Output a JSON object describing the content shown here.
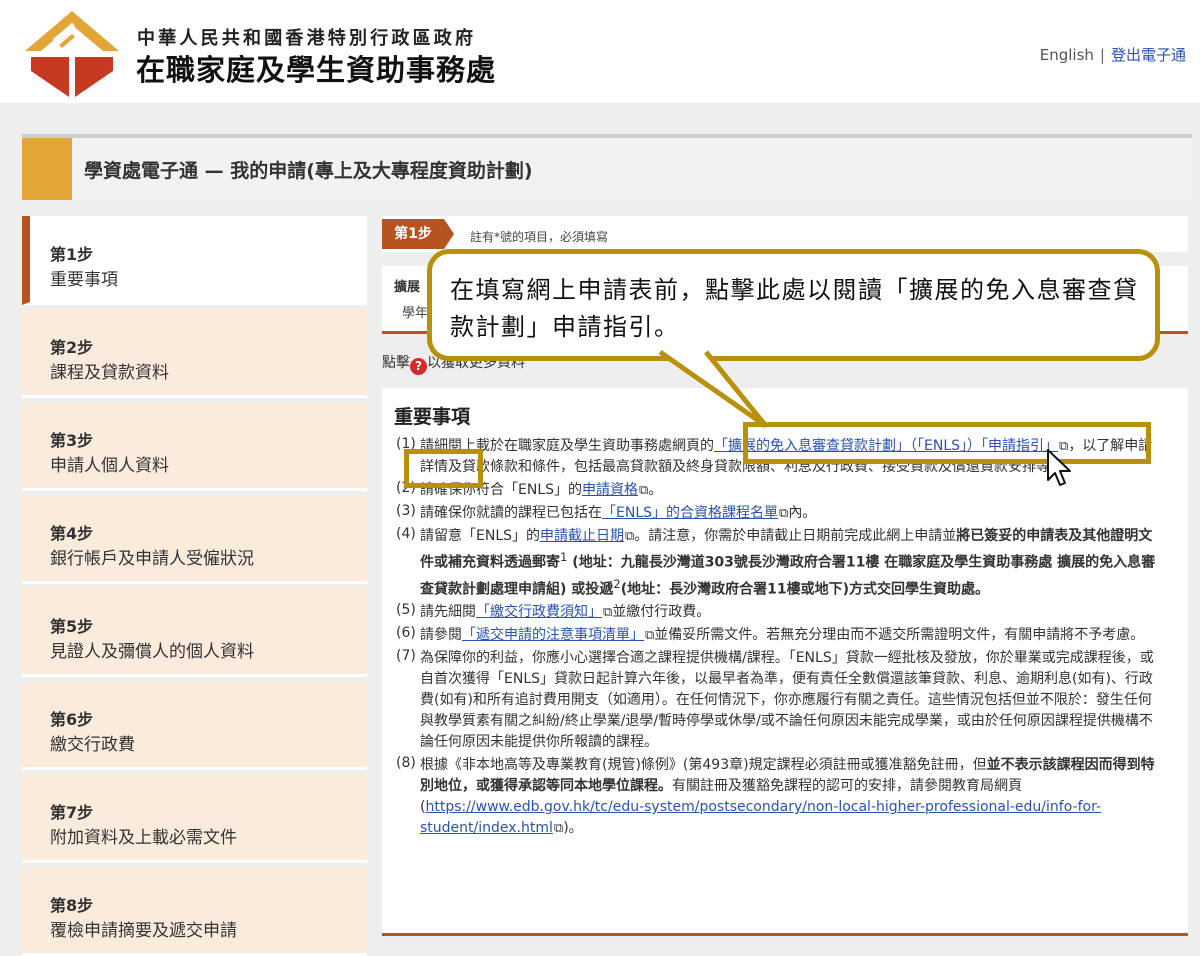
{
  "header": {
    "dept_line1": "中華人民共和國香港特別行政區政府",
    "dept_line2": "在職家庭及學生資助事務處",
    "lang_link": "English",
    "separator": "|",
    "logout": "登出電子通"
  },
  "title_bar": {
    "title": "學資處電子通 — 我的申請(專上及大專程度資助計劃)"
  },
  "sidebar": {
    "items": [
      {
        "num": "第1步",
        "name": "重要事項",
        "active": true
      },
      {
        "num": "第2步",
        "name": "課程及貸款資料"
      },
      {
        "num": "第3步",
        "name": "申請人個人資料"
      },
      {
        "num": "第4步",
        "name": "銀行帳戶及申請人受僱狀況"
      },
      {
        "num": "第5步",
        "name": "見證人及彌償人的個人資料"
      },
      {
        "num": "第6步",
        "name": "繳交行政費"
      },
      {
        "num": "第7步",
        "name": "附加資料及上載必需文件"
      },
      {
        "num": "第8步",
        "name": "覆檢申請摘要及遞交申請"
      }
    ]
  },
  "main": {
    "step_badge": "第1步",
    "step_note": "註有*號的項目，必須填寫",
    "scheme_label": "擴展",
    "scheme_year": "學年",
    "help_text_a": "點擊",
    "help_text_b": "以獲取更多資料",
    "section_title": "重要事項",
    "notices": {
      "n1": {
        "num": "(1)",
        "pre": "請細閱上載於在職家庭及學生資助事務處網頁的",
        "link": "「擴展的免入息審查貸款計劃」（「ENLS」）「申請指引」",
        "post": "，以了解申請詳情及貸款條款和條件，包括最高貸款額及終身貸款限額、利息及行政費、接受貸款及償還貸款安排等。"
      },
      "n2": {
        "num": "(2)",
        "pre": "請確保你符合「ENLS」的",
        "link": "申請資格",
        "post": "。"
      },
      "n3": {
        "num": "(3)",
        "pre": "請確保你就讀的課程已包括在",
        "link": "「ENLS」的合資格課程名單",
        "post": "內。"
      },
      "n4": {
        "num": "(4)",
        "pre": "請留意「ENLS」的",
        "link": "申請截止日期",
        "mid": "。請注意，你需於申請截止日期前完成此網上申請並",
        "bold1": "將已簽妥的申請表及其他證明文件或補充資料透過郵寄",
        "sup1": "1",
        "bold2": " (地址：九龍長沙灣道303號長沙灣政府合署11樓 在職家庭及學生資助事務處 擴展的免入息審查貸款計劃處理申請組) 或投遞",
        "sup2": "2",
        "bold3": "(地址：長沙灣政府合署11樓或地下)方式交回學生資助處。"
      },
      "n5": {
        "num": "(5)",
        "pre": "請先細閱",
        "link": "「繳交行政費須知」",
        "post": "並繳付行政費。"
      },
      "n6": {
        "num": "(6)",
        "pre": "請參閱",
        "link": "「遞交申請的注意事項清單」",
        "post": "並備妥所需文件。若無充分理由而不遞交所需證明文件，有關申請將不予考慮。"
      },
      "n7": {
        "num": "(7)",
        "text": "為保障你的利益，你應小心選擇合適之課程提供機構/課程。「ENLS」貸款一經批核及發放，你於畢業或完成課程後，或自首次獲得「ENLS」貸款日起計算六年後，以最早者為準，便有責任全數償還該筆貸款、利息、逾期利息(如有)、行政費(如有)和所有追討費用開支（如適用）。在任何情況下，你亦應履行有關之責任。這些情況包括但並不限於：發生任何與教學質素有關之糾紛/終止學業/退學/暫時停學或休學/或不論任何原因未能完成學業，或由於任何原因課程提供機構不論任何原因未能提供你所報讀的課程。"
      },
      "n8": {
        "num": "(8)",
        "pre": "根據《非本地高等及專業教育(規管)條例》(第493章)規定課程必須註冊或獲准豁免註冊，但",
        "bold": "並不表示該課程因而得到特別地位，或獲得承認等同本地學位課程。",
        "mid": "有關註冊及獲豁免課程的認可的安排，請參閱教育局網頁(",
        "link": "https://www.edb.gov.hk/tc/edu-system/postsecondary/non-local-higher-professional-edu/info-for-student/index.html",
        "post": ")。"
      }
    }
  },
  "callout": {
    "text": "在填寫網上申請表前，點擊此處以閱讀「擴展的免入息審查貸款計劃」申請指引。"
  },
  "colors": {
    "accent": "#b7531f",
    "gold": "#e3a537",
    "callout_border": "#b8900a",
    "sidebar_bg": "#fbebdd"
  }
}
